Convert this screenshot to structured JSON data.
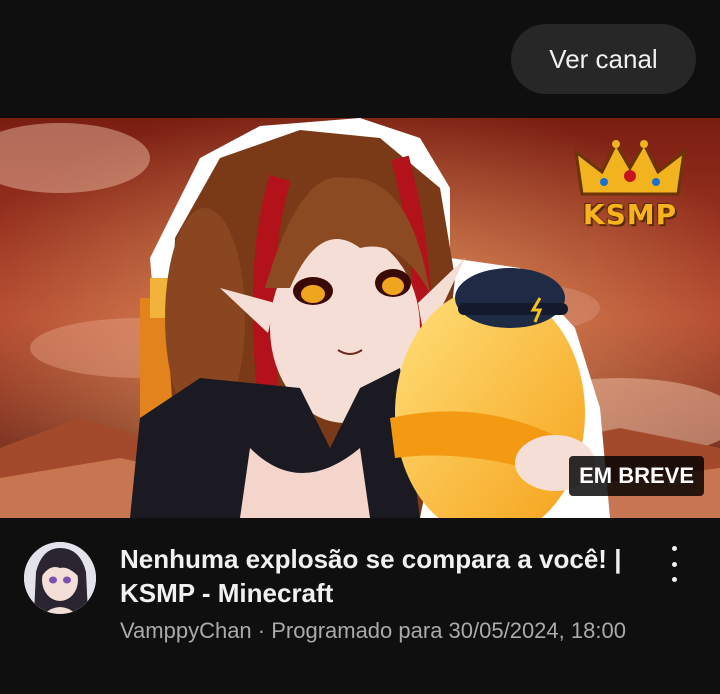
{
  "header": {
    "ver_canal_label": "Ver canal"
  },
  "thumbnail": {
    "logo_text": "KSMP",
    "badge_label": "EM BREVE"
  },
  "video": {
    "title": "Nenhuma explosão se compara a você! | KSMP - Minecraft",
    "subtitle": "VamppyChan · Programado para 30/05/2024, 18:00"
  },
  "colors": {
    "background": "#0f0f0f",
    "button_bg": "#272727",
    "secondary_text": "#aaaaaa",
    "logo_gold": "#f7b31b"
  },
  "icons": {
    "menu": "more-vert-icon",
    "logo": "crown-icon"
  }
}
